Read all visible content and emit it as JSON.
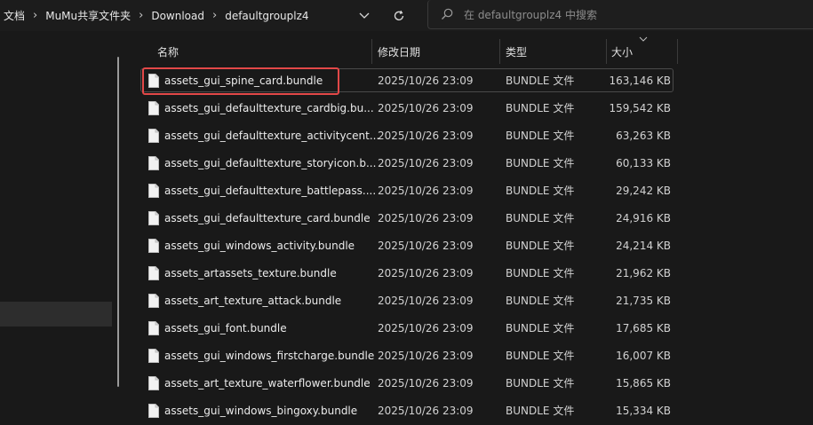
{
  "breadcrumb": {
    "items": [
      "文档",
      "MuMu共享文件夹",
      "Download",
      "defaultgrouplz4"
    ],
    "separator": "›"
  },
  "search": {
    "placeholder": "在 defaultgrouplz4 中搜索"
  },
  "columns": {
    "name": "名称",
    "modified": "修改日期",
    "type": "类型",
    "size": "大小"
  },
  "files": [
    {
      "name": "assets_gui_spine_card.bundle",
      "modified": "2025/10/26 23:09",
      "type": "BUNDLE 文件",
      "size": "163,146 KB",
      "highlighted": true
    },
    {
      "name": "assets_gui_defaulttexture_cardbig.bu...",
      "modified": "2025/10/26 23:09",
      "type": "BUNDLE 文件",
      "size": "159,542 KB"
    },
    {
      "name": "assets_gui_defaulttexture_activitycent...",
      "modified": "2025/10/26 23:09",
      "type": "BUNDLE 文件",
      "size": "63,263 KB"
    },
    {
      "name": "assets_gui_defaulttexture_storyicon.b...",
      "modified": "2025/10/26 23:09",
      "type": "BUNDLE 文件",
      "size": "60,133 KB"
    },
    {
      "name": "assets_gui_defaulttexture_battlepass....",
      "modified": "2025/10/26 23:09",
      "type": "BUNDLE 文件",
      "size": "29,242 KB"
    },
    {
      "name": "assets_gui_defaulttexture_card.bundle",
      "modified": "2025/10/26 23:09",
      "type": "BUNDLE 文件",
      "size": "24,916 KB"
    },
    {
      "name": "assets_gui_windows_activity.bundle",
      "modified": "2025/10/26 23:09",
      "type": "BUNDLE 文件",
      "size": "24,214 KB"
    },
    {
      "name": "assets_artassets_texture.bundle",
      "modified": "2025/10/26 23:09",
      "type": "BUNDLE 文件",
      "size": "21,962 KB"
    },
    {
      "name": "assets_art_texture_attack.bundle",
      "modified": "2025/10/26 23:09",
      "type": "BUNDLE 文件",
      "size": "21,735 KB"
    },
    {
      "name": "assets_gui_font.bundle",
      "modified": "2025/10/26 23:09",
      "type": "BUNDLE 文件",
      "size": "17,685 KB"
    },
    {
      "name": "assets_gui_windows_firstcharge.bundle",
      "modified": "2025/10/26 23:09",
      "type": "BUNDLE 文件",
      "size": "16,007 KB"
    },
    {
      "name": "assets_art_texture_waterflower.bundle",
      "modified": "2025/10/26 23:09",
      "type": "BUNDLE 文件",
      "size": "15,865 KB"
    },
    {
      "name": "assets_gui_windows_bingoxy.bundle",
      "modified": "2025/10/26 23:09",
      "type": "BUNDLE 文件",
      "size": "15,334 KB"
    }
  ],
  "icons": {
    "dropdown": "chevron-down-icon",
    "refresh": "refresh-icon",
    "search": "search-icon",
    "file": "file-icon",
    "sort": "sort-chevron-icon"
  },
  "colors": {
    "highlight": "#e24848",
    "background": "#191919"
  }
}
